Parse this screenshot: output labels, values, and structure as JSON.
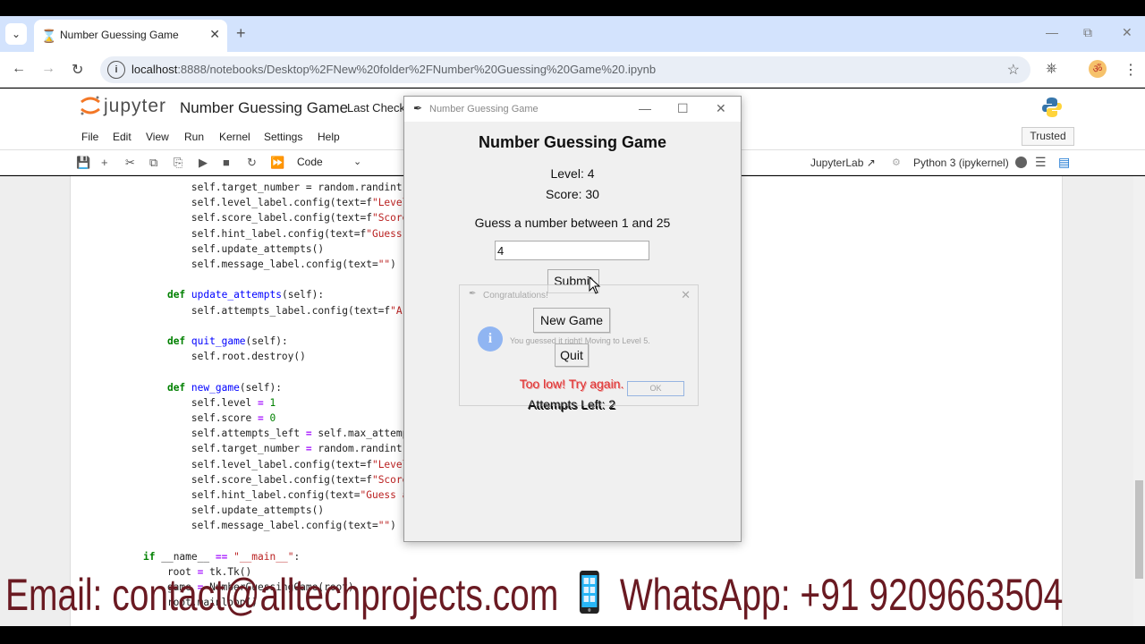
{
  "browser": {
    "tab_title": "Number Guessing Game",
    "url_host": "localhost",
    "url_path": ":8888/notebooks/Desktop%2FNew%20folder%2FNumber%20Guessing%20Game%20.ipynb"
  },
  "jupyter": {
    "brand": "jupyter",
    "notebook_title": "Number Guessing Game",
    "checkpoint": "Last Checkp",
    "menu": [
      "File",
      "Edit",
      "View",
      "Run",
      "Kernel",
      "Settings",
      "Help"
    ],
    "trusted": "Trusted",
    "cell_type": "Code",
    "jupyterlab_link": "JupyterLab",
    "kernel_name": "Python 3 (ipykernel)"
  },
  "game": {
    "window_title": "Number Guessing Game",
    "heading": "Number Guessing Game",
    "level": "Level: 4",
    "score": "Score: 30",
    "hint": "Guess a number between 1 and 25",
    "entry_value": "4",
    "submit_label": "Submit",
    "new_game_label": "New Game",
    "quit_label": "Quit",
    "message": "Too low! Try again.",
    "attempts": "Attempts Left: 2"
  },
  "messagebox": {
    "title": "Congratulations!",
    "text": "You guessed it right! Moving to Level 5.",
    "ok_label": "OK"
  },
  "banner": {
    "email": "Email: contact@alltechprojects.com",
    "whatsapp": "WhatsApp: +91 9209663504"
  },
  "colors": {
    "banner_text": "#6a1a22",
    "message_text": "#e03030",
    "tabstrip": "#d3e3fd"
  }
}
